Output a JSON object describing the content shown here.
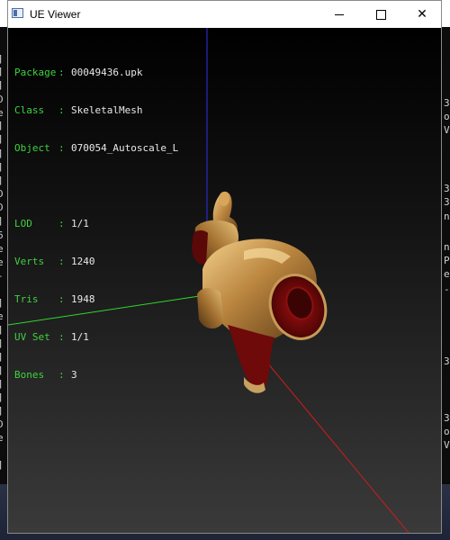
{
  "window": {
    "title": "UE Viewer",
    "minimize_glyph": "minimize-icon",
    "maximize_glyph": "maximize-icon",
    "close_symbol": "✕"
  },
  "info": {
    "package": {
      "label": "Package",
      "sep": ":",
      "value": "00049436.upk"
    },
    "class": {
      "label": "Class",
      "sep": ":",
      "value": "SkeletalMesh"
    },
    "object": {
      "label": "Object",
      "sep": ":",
      "value": "070054_Autoscale_L"
    },
    "lod": {
      "label": "LOD",
      "sep": ":",
      "value": "1/1"
    },
    "verts": {
      "label": "Verts",
      "sep": ":",
      "value": "1240"
    },
    "tris": {
      "label": "Tris",
      "sep": ":",
      "value": "1948"
    },
    "uvset": {
      "label": "UV Set",
      "sep": ":",
      "value": "1/1"
    },
    "bones": {
      "label": "Bones",
      "sep": ":",
      "value": "3"
    }
  },
  "colors": {
    "label_text": "#3fd23f",
    "value_text": "#e8e8e8",
    "axis_x": "#c81e1e",
    "axis_y": "#2ed82e",
    "axis_z": "#2a2ac8",
    "viewport_bg": "#000000"
  },
  "background": {
    "left_chars": [
      "]",
      "]",
      "]",
      "D",
      "e",
      "]",
      "]",
      "]",
      "]",
      "]",
      "D",
      "D",
      "]",
      "6",
      "e",
      "e",
      "-",
      "]",
      "e",
      "]",
      "]",
      "]",
      "]",
      "]",
      "]",
      "]",
      "D",
      "e",
      "]"
    ],
    "right_chars": [
      "3",
      "o",
      "V",
      "3",
      "3",
      "n",
      "n",
      "P",
      "e",
      "-",
      "3",
      "3",
      "o",
      "V"
    ]
  }
}
